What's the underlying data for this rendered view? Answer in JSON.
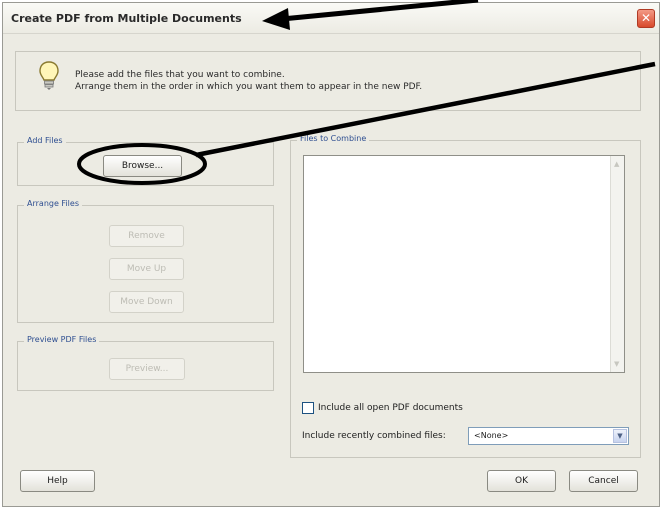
{
  "window": {
    "title": "Create PDF from Multiple Documents",
    "close_label": "✕"
  },
  "info": {
    "line1": "Please add the files that you want to combine.",
    "line2": "Arrange them in the order in which you want them to appear in the new PDF."
  },
  "add_files": {
    "label": "Add Files",
    "browse": "Browse..."
  },
  "arrange_files": {
    "label": "Arrange Files",
    "remove": "Remove",
    "move_up": "Move Up",
    "move_down": "Move Down"
  },
  "preview": {
    "label": "Preview PDF Files",
    "preview_button": "Preview..."
  },
  "files_to_combine": {
    "label": "Files to Combine",
    "include_open_label": "Include all open PDF documents",
    "include_recent_label": "Include recently combined files:",
    "recent_selected": "<None>"
  },
  "footer": {
    "help": "Help",
    "ok": "OK",
    "cancel": "Cancel"
  },
  "colors": {
    "dialog_bg": "#ecebe3",
    "group_label": "#2f4f91",
    "annotation": "#000000"
  }
}
